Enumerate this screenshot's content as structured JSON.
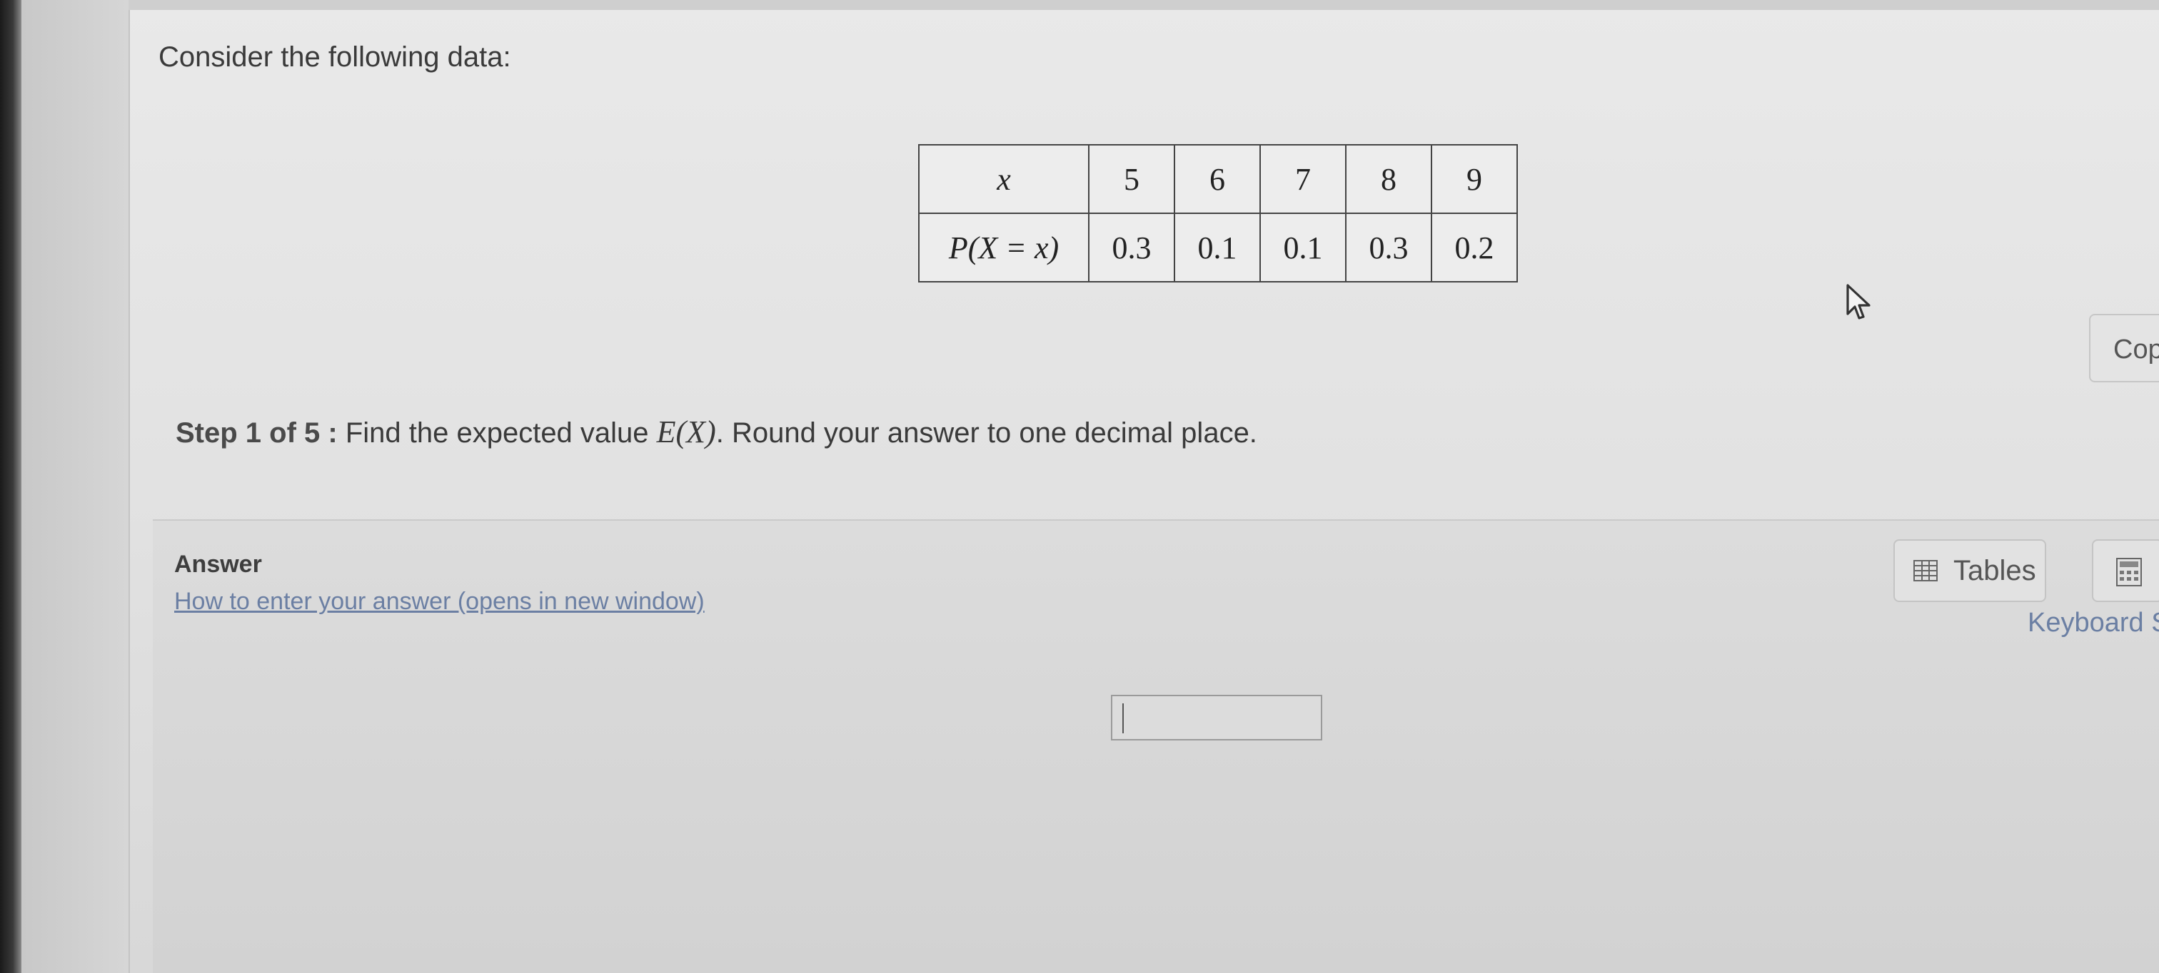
{
  "question": {
    "intro": "Consider the following data:"
  },
  "table": {
    "row_x_label": "x",
    "row_p_label": "P(X = x)",
    "x_values": [
      "5",
      "6",
      "7",
      "8",
      "9"
    ],
    "p_values": [
      "0.3",
      "0.1",
      "0.1",
      "0.3",
      "0.2"
    ]
  },
  "step": {
    "label": "Step 1 of 5 :",
    "text_before": " Find the expected value ",
    "math": "E(X)",
    "text_after": ". Round your answer to one decimal place."
  },
  "answer": {
    "label": "Answer",
    "help_link": "How to enter your answer (opens in new window)",
    "input_value": ""
  },
  "toolbar": {
    "tables_label": "Tables",
    "keyboard_label": "Keyboard S",
    "copy_label": "Cop"
  },
  "icons": {
    "tables": "grid-icon",
    "calculator": "calculator-icon",
    "cursor": "mouse-cursor-icon"
  }
}
